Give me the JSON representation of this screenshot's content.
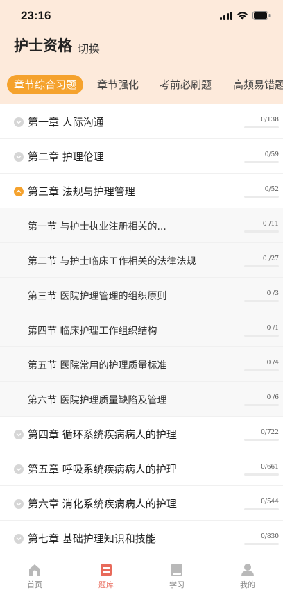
{
  "status_bar": {
    "time": "23:16"
  },
  "header": {
    "title": "护士资格",
    "switch_label": "切换"
  },
  "tabs": [
    {
      "label": "章节综合习题",
      "active": true
    },
    {
      "label": "章节强化",
      "active": false
    },
    {
      "label": "考前必刷题",
      "active": false
    },
    {
      "label": "高频易错题",
      "active": false
    }
  ],
  "chapters": [
    {
      "label": "第一章 人际沟通",
      "count": "0/138",
      "expanded": false
    },
    {
      "label": "第二章 护理伦理",
      "count": "0/59",
      "expanded": false
    },
    {
      "label": "第三章 法规与护理管理",
      "count": "0/52",
      "expanded": true
    },
    {
      "label": "第一节 与护士执业注册相关的...",
      "count": "0 /11",
      "sub": true
    },
    {
      "label": "第二节 与护士临床工作相关的法律法规",
      "count": "0 /27",
      "sub": true
    },
    {
      "label": "第三节 医院护理管理的组织原则",
      "count": "0 /3",
      "sub": true
    },
    {
      "label": "第四节 临床护理工作组织结构",
      "count": "0 /1",
      "sub": true
    },
    {
      "label": "第五节 医院常用的护理质量标准",
      "count": "0 /4",
      "sub": true
    },
    {
      "label": "第六节 医院护理质量缺陷及管理",
      "count": "0 /6",
      "sub": true
    },
    {
      "label": "第四章 循环系统疾病病人的护理",
      "count": "0/722",
      "expanded": false
    },
    {
      "label": "第五章 呼吸系统疾病病人的护理",
      "count": "0/661",
      "expanded": false
    },
    {
      "label": "第六章 消化系统疾病病人的护理",
      "count": "0/544",
      "expanded": false
    },
    {
      "label": "第七章 基础护理知识和技能",
      "count": "0/830",
      "expanded": false
    }
  ],
  "bottom_nav": [
    {
      "label": "首页",
      "icon": "home-icon",
      "active": false
    },
    {
      "label": "题库",
      "icon": "question-bank-icon",
      "active": true
    },
    {
      "label": "学习",
      "icon": "book-icon",
      "active": false
    },
    {
      "label": "我的",
      "icon": "user-icon",
      "active": false
    }
  ],
  "colors": {
    "accent": "#f5a22d",
    "header_bg": "#fdeadb",
    "nav_active": "#e86a5b"
  }
}
